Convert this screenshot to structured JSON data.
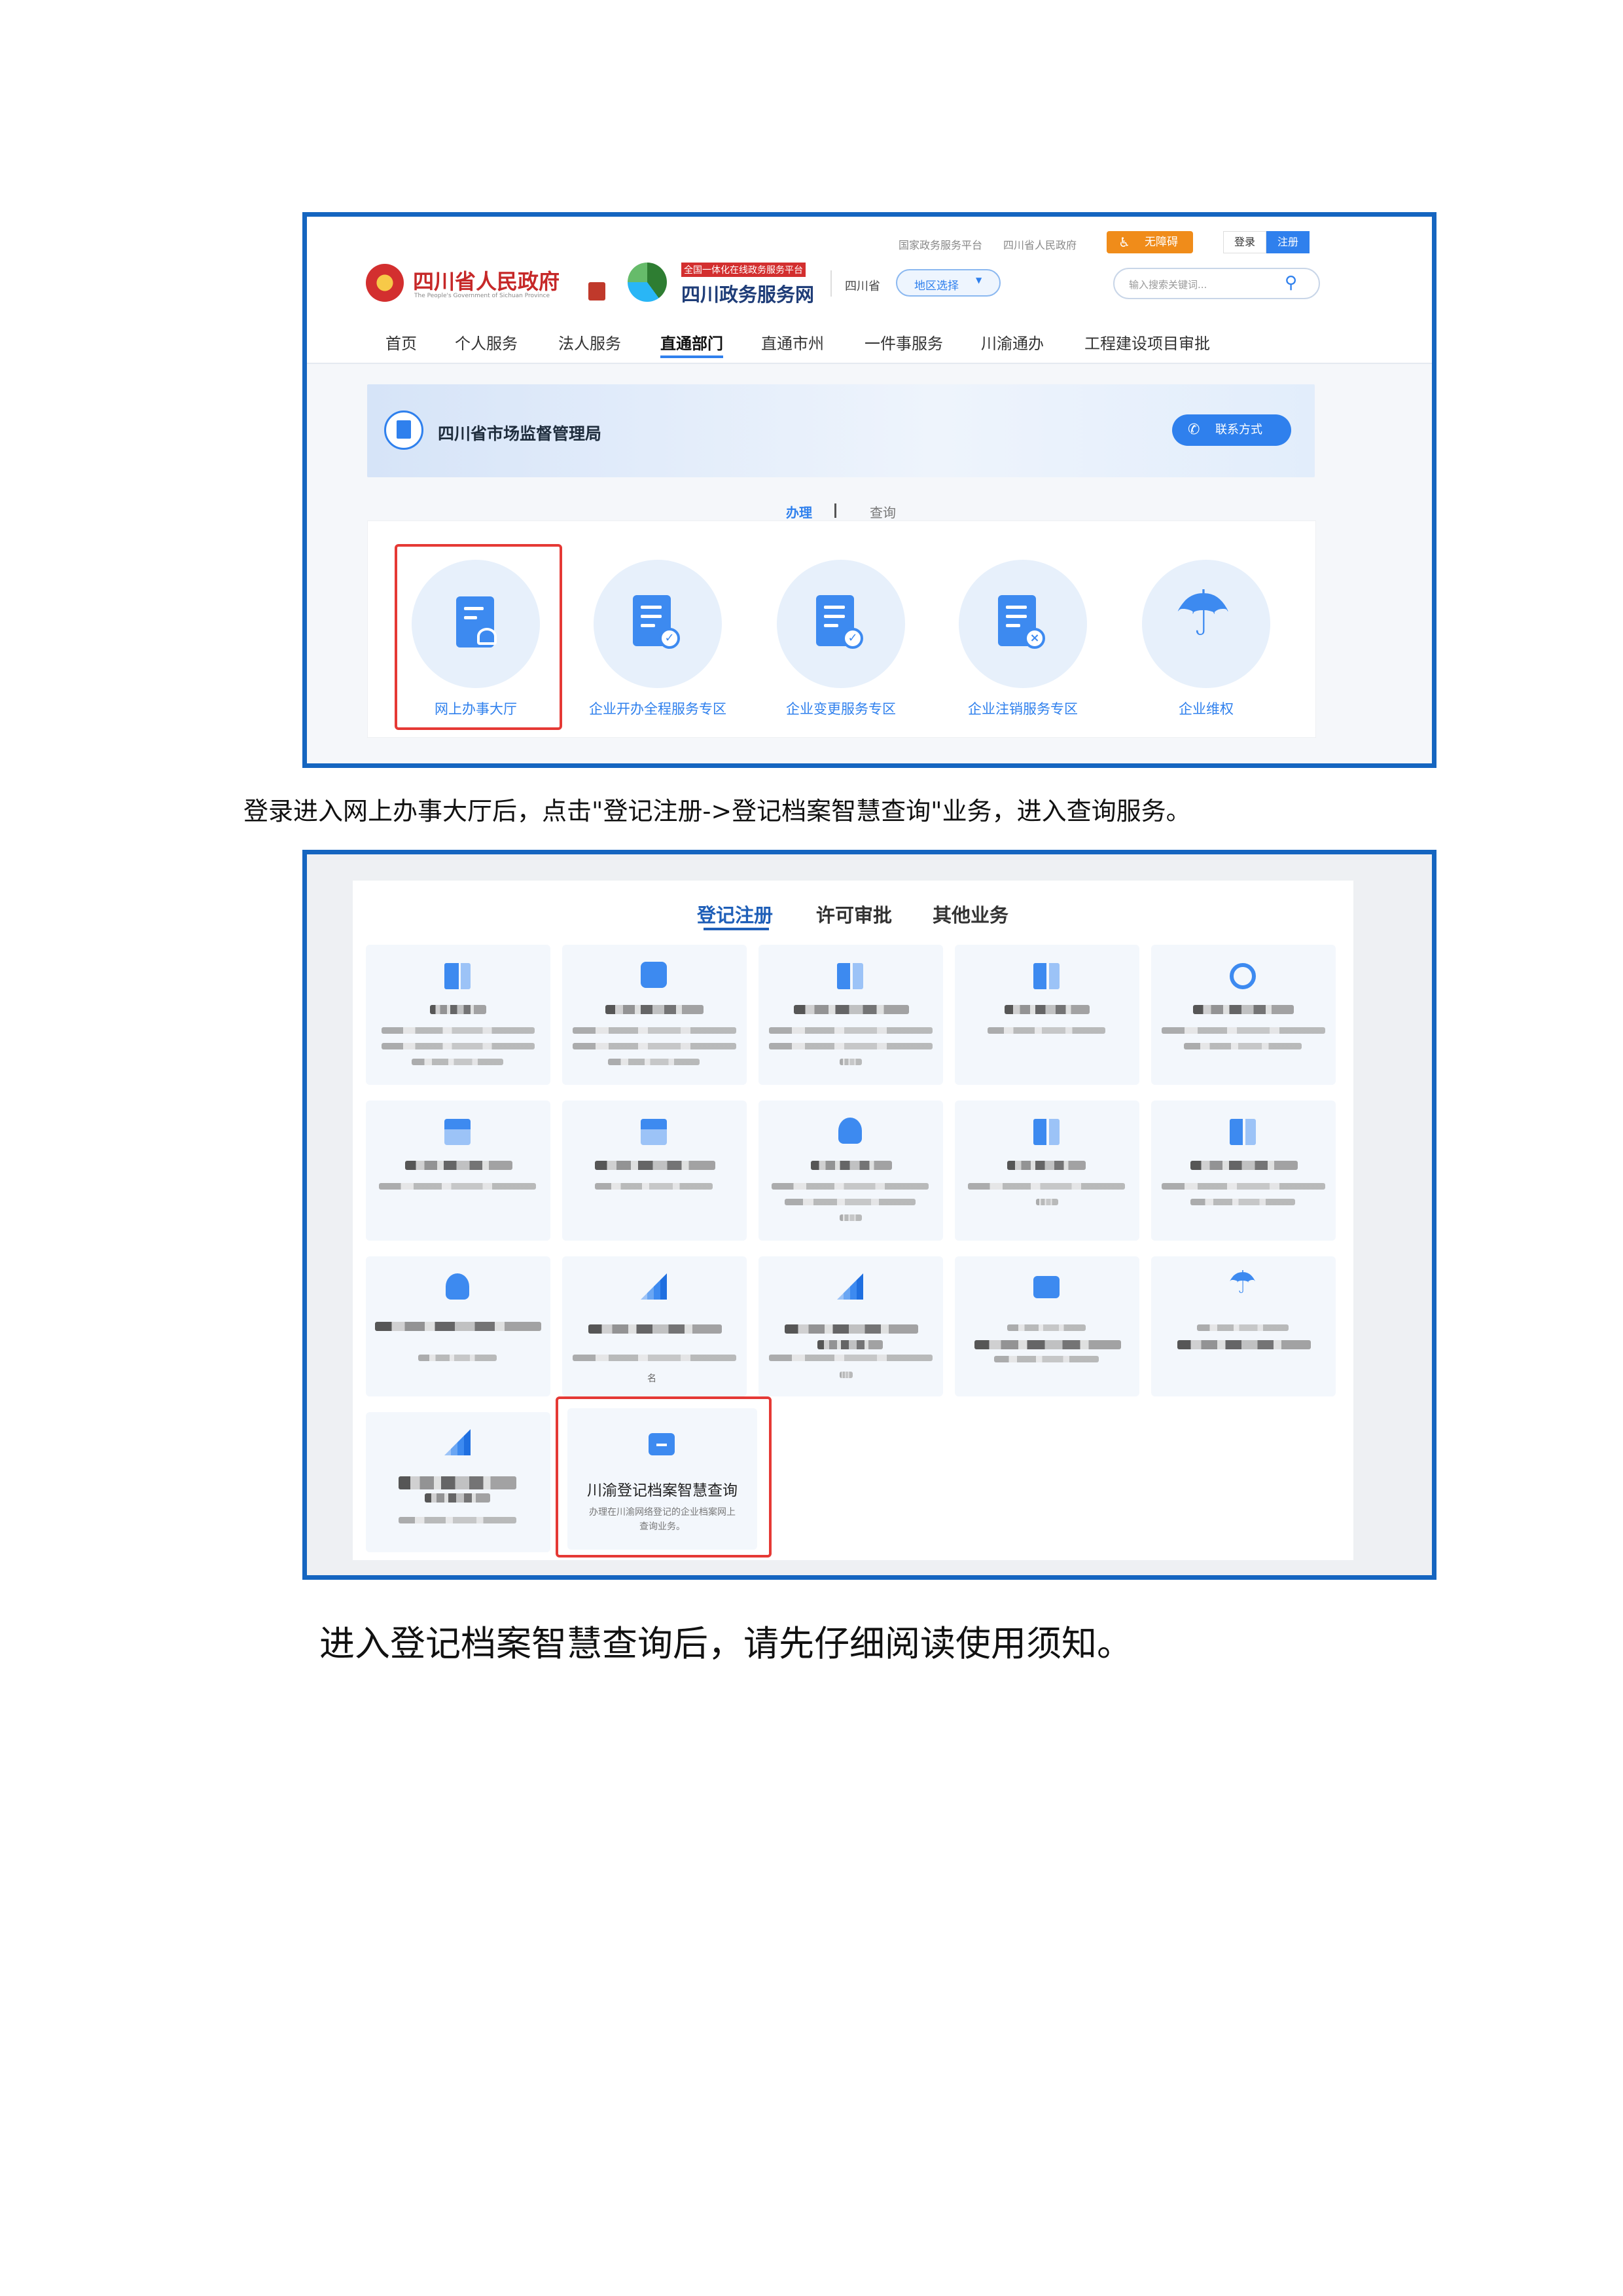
{
  "screenshot1": {
    "header": {
      "top_links": [
        "国家政务服务平台",
        "四川省人民政府"
      ],
      "accessibility_label": "无障碍",
      "login_label": "登录",
      "register_label": "注册",
      "gov_logo_text": "四川省人民政府",
      "gov_logo_subtitle": "The People's Government of Sichuan Province",
      "portal_badge": "全国一体化在线政务服务平台",
      "portal_name": "四川政务服务网",
      "region_name": "四川省",
      "region_select": "地区选择",
      "search_placeholder": "输入搜索关键词..."
    },
    "nav": [
      "首页",
      "个人服务",
      "法人服务",
      "直通部门",
      "直通市州",
      "一件事服务",
      "川渝通办",
      "工程建设项目审批"
    ],
    "nav_active_index": 3,
    "department_banner": {
      "name": "四川省市场监督管理局",
      "contact_button": "联系方式"
    },
    "tabs": {
      "active": "办理",
      "other": "查询"
    },
    "services": [
      "网上办事大厅",
      "企业开办全程服务专区",
      "企业变更服务专区",
      "企业注销服务专区",
      "企业维权"
    ],
    "highlighted_service_index": 0
  },
  "caption1": "登录进入网上办事大厅后，点击\"登记注册->登记档案智慧查询\"业务，进入查询服务。",
  "screenshot2": {
    "tabs": [
      "登记注册",
      "许可审批",
      "其他业务"
    ],
    "active_tab_index": 0,
    "tile_icons": [
      "building-icon",
      "phone-icon",
      "building-transfer-icon",
      "building-transfer-icon",
      "ban-icon",
      "shop-icon",
      "shop-icon",
      "medal-icon",
      "building-transfer-icon",
      "building-transfer-icon",
      "medal-icon",
      "chart-icon",
      "chart-icon",
      "briefcase-icon",
      "umbrella-icon",
      "chart-icon",
      "briefcase-icon"
    ],
    "blurred_fragment": "名",
    "highlighted_tile": {
      "title": "川渝登记档案智慧查询",
      "description_line1": "办理在川渝网络登记的企业档案网上",
      "description_line2": "查询业务。"
    }
  },
  "caption2": "进入登记档案智慧查询后，请先仔细阅读使用须知。",
  "colors": {
    "frame": "#1565c0",
    "highlight": "#e53935",
    "accent": "#2f80ed",
    "orange": "#f08c1a"
  }
}
